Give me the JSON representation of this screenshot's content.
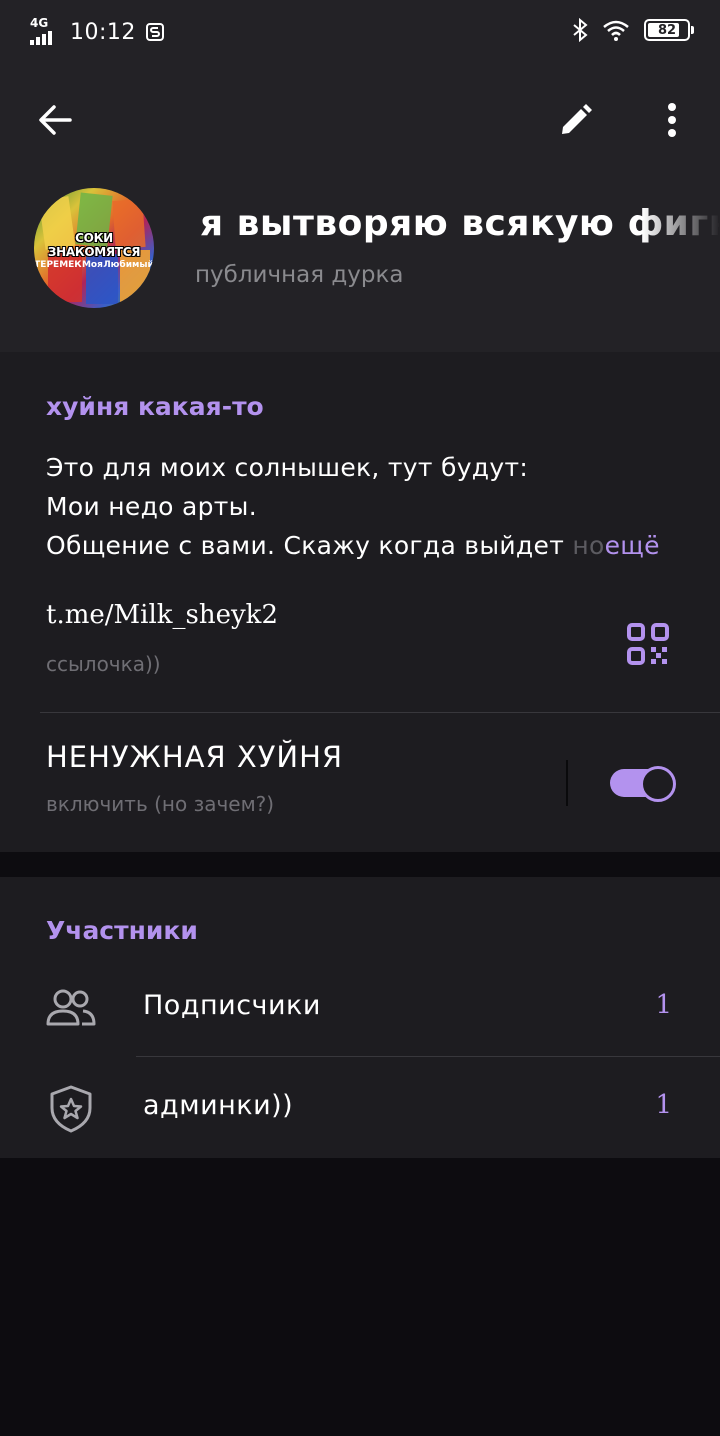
{
  "status_bar": {
    "network": "4G",
    "time": "10:12",
    "battery": "82",
    "battery_level": 0.82
  },
  "channel": {
    "title": "я вытворяю всякую фигн",
    "subtitle": "публичная дурка",
    "avatar_caption": "СОКИ ЗНАКОМЯТСЯ",
    "avatar_labels": [
      "ТЕРЕМЕК",
      "Моя",
      "Любимый"
    ]
  },
  "info": {
    "section_title": "хуйня какая-то",
    "about_lines": [
      "Это для моих солнышек, тут будут:",
      "Мои недо арты.",
      "Общение с вами. Скажу когда выйдет "
    ],
    "about_fade": "но",
    "more": "ещё",
    "link": "t.me/Milk_sheyk2",
    "link_caption": "ссылочка))",
    "toggle_title": "НЕНУЖНАЯ ХУЙНЯ",
    "toggle_caption": "включить (но зачем?)",
    "toggle_on": true
  },
  "members": {
    "section_title": "Участники",
    "rows": [
      {
        "label": "Подписчики",
        "count": "1",
        "icon": "people-icon"
      },
      {
        "label": "админки))",
        "count": "1",
        "icon": "shield-star-icon"
      }
    ]
  },
  "colors": {
    "accent": "#b392ee",
    "header_bg": "#232226",
    "card_bg": "#1d1c20",
    "page_bg": "#0d0c10"
  }
}
